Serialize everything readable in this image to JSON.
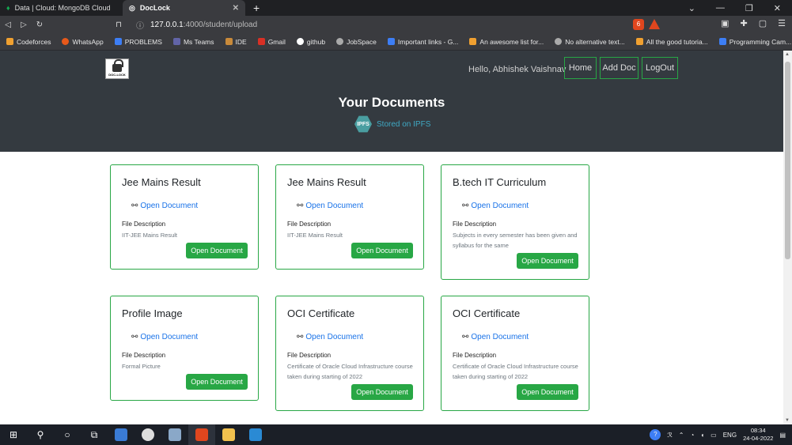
{
  "browser": {
    "tabs": [
      {
        "title": "Data | Cloud: MongoDB Cloud",
        "active": false
      },
      {
        "title": "DocLock",
        "active": true
      }
    ],
    "url_host": "127.0.0.1",
    "url_rest": ":4000/student/upload",
    "shield_count": "6",
    "bookmarks": [
      {
        "label": "Codeforces",
        "color": "#f0a030"
      },
      {
        "label": "WhatsApp",
        "color": "#e8591a"
      },
      {
        "label": "PROBLEMS",
        "color": "#3d7ef5"
      },
      {
        "label": "Ms Teams",
        "color": "#6264a7"
      },
      {
        "label": "IDE",
        "color": "#c98a3a"
      },
      {
        "label": "Gmail",
        "color": "#d93025"
      },
      {
        "label": "github",
        "color": "#ffffff"
      },
      {
        "label": "JobSpace",
        "color": "#aaaaaa"
      },
      {
        "label": "Important links - G...",
        "color": "#3d7ef5"
      },
      {
        "label": "An awesome list for...",
        "color": "#f0a030"
      },
      {
        "label": "No alternative text...",
        "color": "#aaaaaa"
      },
      {
        "label": "All the good tutoria...",
        "color": "#f0a030"
      },
      {
        "label": "Programming Cam...",
        "color": "#3d7ef5"
      }
    ],
    "bookmarks_more": "»"
  },
  "site": {
    "logo_text": "DOC-LOCK",
    "greeting": "Hello, Abhishek Vaishnav",
    "nav": [
      "Home",
      "Add Doc",
      "LogOut"
    ],
    "title": "Your Documents",
    "ipfs_badge": "IPFS",
    "ipfs_text": "Stored on IPFS",
    "accent": "#28a745"
  },
  "cards": [
    {
      "title": "Jee Mains Result",
      "link": "Open Document",
      "desc_label": "File Description",
      "desc": "IIT-JEE Mains Result",
      "button": "Open Document"
    },
    {
      "title": "Jee Mains Result",
      "link": "Open Document",
      "desc_label": "File Description",
      "desc": "IIT-JEE Mains Result",
      "button": "Open Document"
    },
    {
      "title": "B.tech IT Curriculum",
      "link": "Open Document",
      "desc_label": "File Description",
      "desc": "Subjects in every semester has been given and syllabus for the same",
      "button": "Open Document"
    },
    {
      "title": "Profile Image",
      "link": "Open Document",
      "desc_label": "File Description",
      "desc": "Formal Picture",
      "button": "Open Document"
    },
    {
      "title": "OCI Certificate",
      "link": "Open Document",
      "desc_label": "File Description",
      "desc": "Certificate of Oracle Cloud Infrastructure course taken during starting of 2022",
      "button": "Open Document"
    },
    {
      "title": "OCI Certificate",
      "link": "Open Document",
      "desc_label": "File Description",
      "desc": "Certificate of Oracle Cloud Infrastructure course taken during starting of 2022",
      "button": "Open Document"
    }
  ],
  "taskbar": {
    "lang": "ENG",
    "time": "08:34",
    "date": "24-04-2022"
  }
}
